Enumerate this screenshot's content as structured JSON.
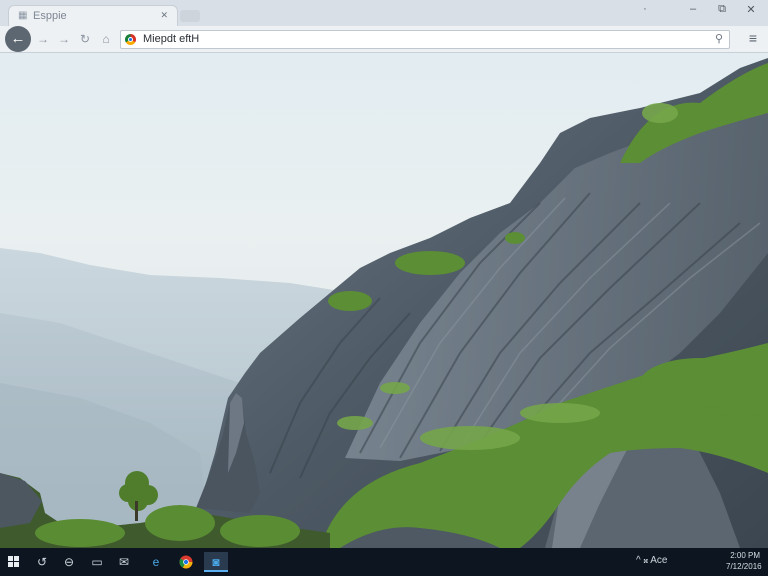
{
  "browser": {
    "tab": {
      "title": "Esppie",
      "close_icon": "close-icon"
    },
    "window_controls": {
      "minimize": "‒",
      "restore": "⧉",
      "close": "✕"
    },
    "toolbar": {
      "back_icon": "back-arrow-icon",
      "forward_icon": "forward-arrow-icon",
      "reload_icon": "reload-icon",
      "home_icon": "home-icon",
      "menu_icon": "hamburger-menu-icon"
    },
    "address_bar": {
      "value": "Miepdt eftH",
      "end_icon": "bookmark-pin-icon"
    }
  },
  "page": {
    "image": "mountain-cliff-landscape",
    "colors": {
      "sky": "#e4edf1",
      "rock": "#55606c",
      "grass": "#5b8e35"
    }
  },
  "taskbar": {
    "apps": [
      "start",
      "cortana",
      "task-view",
      "file-explorer",
      "mail",
      "edge",
      "chrome",
      "active-app"
    ],
    "tray_text": "^ 𝄪 Ace",
    "clock": {
      "line1": "2:00 PM",
      "line2": "7/12/2016"
    }
  },
  "colors": {
    "taskbar": "#0d1620",
    "chrome": "#eef1f4",
    "accent": "#5ab0f0"
  }
}
